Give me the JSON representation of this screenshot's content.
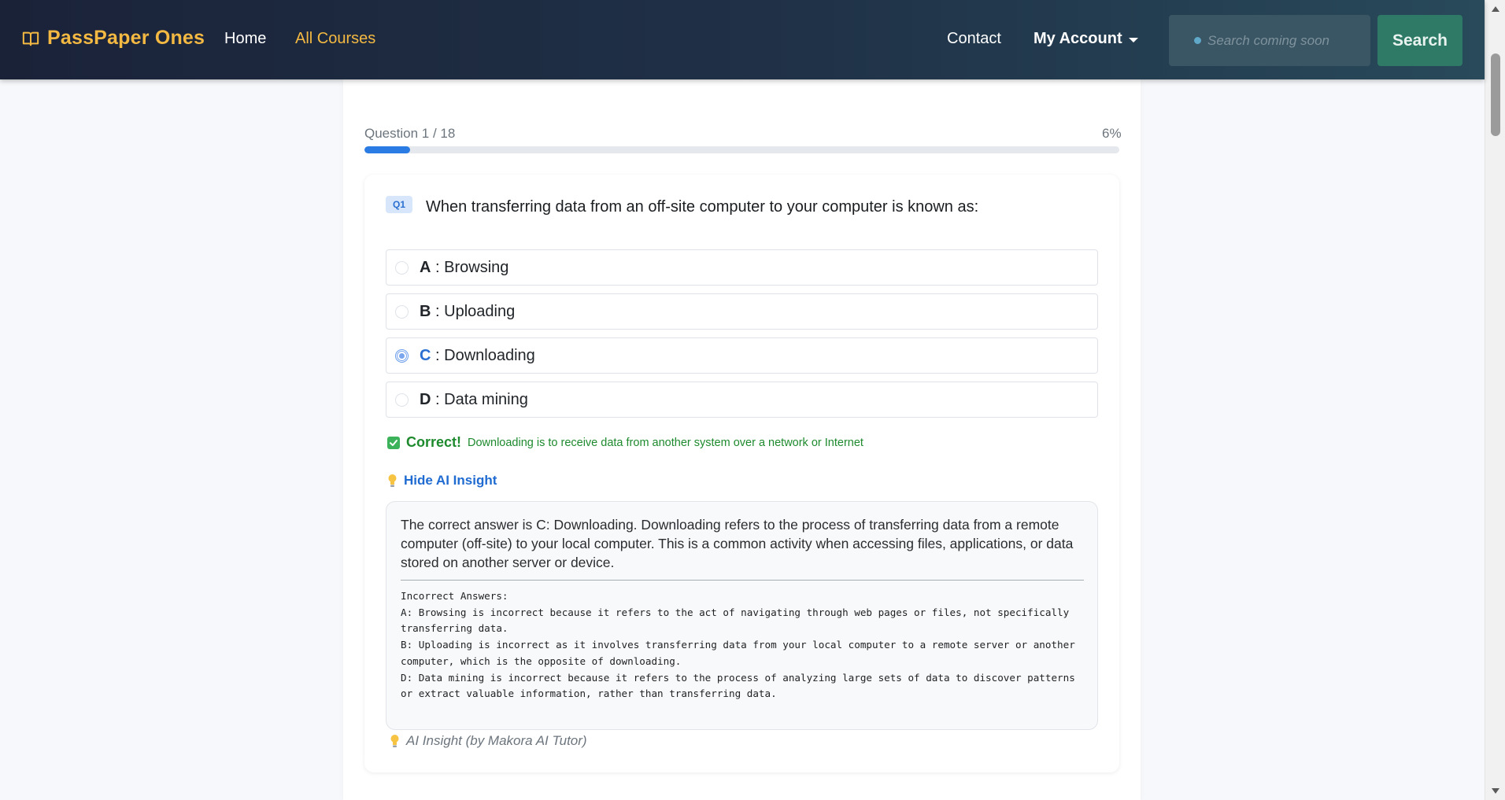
{
  "navbar": {
    "brand": "PassPaper Ones",
    "home": "Home",
    "all_courses": "All Courses",
    "contact": "Contact",
    "my_account": "My Account",
    "search_placeholder": "Search coming soon",
    "search_button": "Search"
  },
  "progress": {
    "label": "Question 1 / 18",
    "percent_text": "6%",
    "fraction": 0.06
  },
  "question": {
    "badge": "Q1",
    "text": "When transferring data from an off-site computer to your computer is known as:",
    "options": [
      {
        "letter": "A",
        "sep": " : ",
        "text": "Browsing",
        "selected": false
      },
      {
        "letter": "B",
        "sep": " : ",
        "text": "Uploading",
        "selected": false
      },
      {
        "letter": "C",
        "sep": " : ",
        "text": "Downloading",
        "selected": true
      },
      {
        "letter": "D",
        "sep": " : ",
        "text": "Data mining",
        "selected": false
      }
    ]
  },
  "feedback": {
    "status": "Correct!",
    "message": "Downloading is to receive data from another system over a network or Internet"
  },
  "insight": {
    "toggle_label": "Hide AI Insight",
    "main": "The correct answer is C: Downloading. Downloading refers to the process of transferring data from a remote computer (off-site) to your local computer. This is a common activity when accessing files, applications, or data stored on another server or device.",
    "incorrect": "Incorrect Answers:\nA: Browsing is incorrect because it refers to the act of navigating through web pages or files, not specifically transferring data.\nB: Uploading is incorrect as it involves transferring data from your local computer to a remote server or another computer, which is the opposite of downloading.\nD: Data mining is incorrect because it refers to the process of analyzing large sets of data to discover patterns or extract valuable information, rather than transferring data.",
    "footer": "AI Insight (by Makora AI Tutor)"
  },
  "colors": {
    "brand": "#f4b942",
    "accent": "#2a7be4",
    "success": "#1e8a2e",
    "search_button": "#2e7a66"
  },
  "icons": {
    "brand": "book-icon",
    "search": "search-dot-icon",
    "feedback": "check-square-icon",
    "insight": "lightbulb-icon"
  }
}
